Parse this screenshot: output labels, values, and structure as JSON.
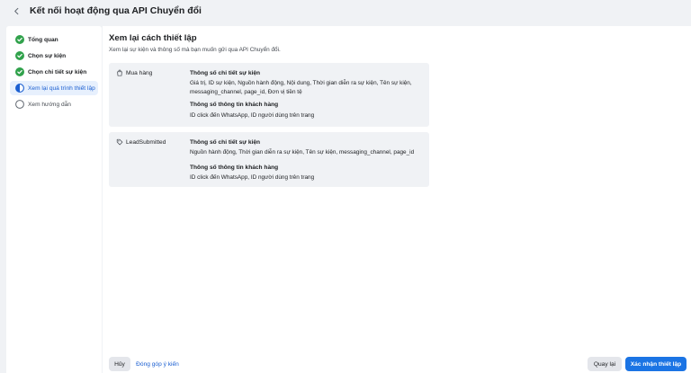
{
  "header": {
    "title": "Kết nối hoạt động qua API Chuyển đổi"
  },
  "sidebar": {
    "steps": [
      {
        "label": "Tổng quan",
        "status": "done"
      },
      {
        "label": "Chọn sự kiện",
        "status": "done"
      },
      {
        "label": "Chọn chi tiết sự kiện",
        "status": "done"
      },
      {
        "label": "Xem lại quá trình thiết lập",
        "status": "active"
      },
      {
        "label": "Xem hướng dẫn",
        "status": "pending"
      }
    ]
  },
  "main": {
    "title": "Xem lại cách thiết lập",
    "subtitle": "Xem lại sự kiện và thông số mà bạn muốn gửi qua API Chuyển đổi.",
    "events": [
      {
        "name": "Mua hàng",
        "icon": "shopping-bag-icon",
        "event_params_title": "Thông số chi tiết sự kiện",
        "event_params": "Giá trị, ID sự kiện, Nguồn hành động, Nội dung, Thời gian diễn ra sự kiện, Tên sự kiện, messaging_channel, page_id, Đơn vị tiền tệ",
        "customer_params_title": "Thông số thông tin khách hàng",
        "customer_params": "ID click đến WhatsApp, ID người dùng trên trang"
      },
      {
        "name": "LeadSubmitted",
        "icon": "lead-tag-icon",
        "event_params_title": "Thông số chi tiết sự kiện",
        "event_params": "Nguồn hành động, Thời gian diễn ra sự kiện, Tên sự kiện, messaging_channel, page_id",
        "customer_params_title": "Thông số thông tin khách hàng",
        "customer_params": "ID click đến WhatsApp, ID người dùng trên trang"
      }
    ]
  },
  "footer": {
    "cancel_label": "Hủy",
    "feedback_label": "Đóng góp ý kiến",
    "back_label": "Quay lại",
    "confirm_label": "Xác nhận thiết lập"
  },
  "colors": {
    "accent": "#1b74e4",
    "done_green": "#31a24c",
    "background": "#f0f2f5"
  }
}
